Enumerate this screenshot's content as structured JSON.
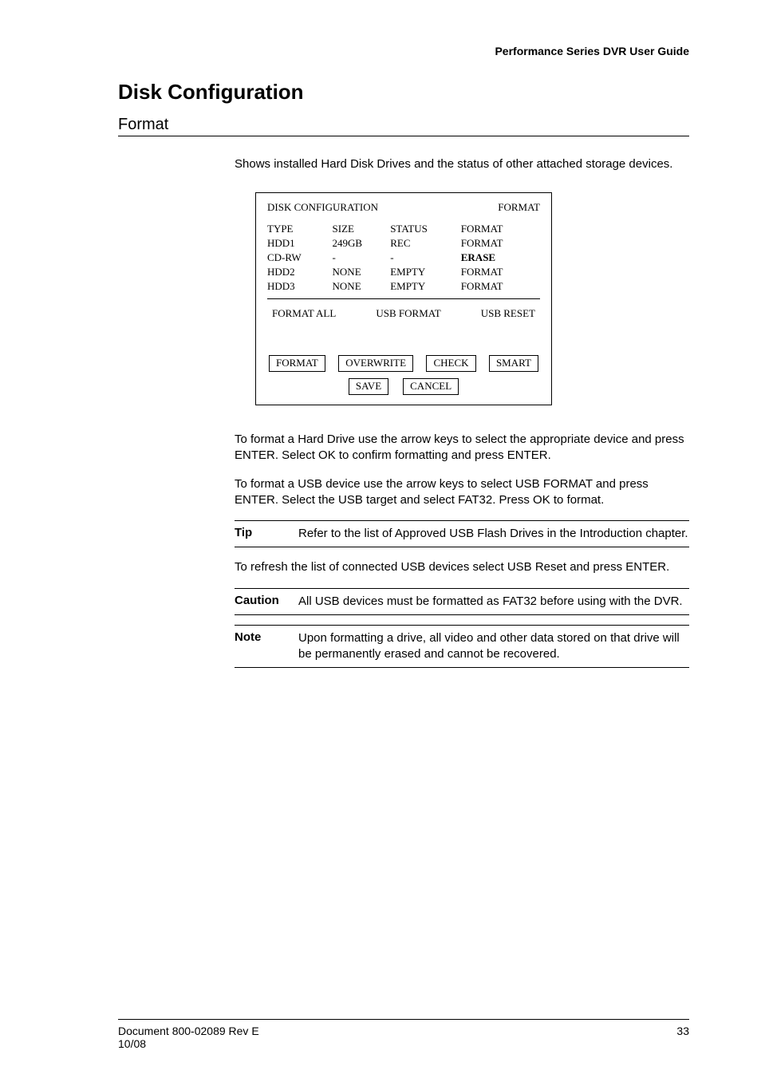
{
  "header": {
    "running_title": "Performance Series DVR User Guide"
  },
  "section": {
    "title": "Disk Configuration"
  },
  "subsection": {
    "heading": "Format",
    "intro": "Shows installed Hard Disk Drives and the status of other attached storage devices."
  },
  "diagram": {
    "title_left": "DISK CONFIGURATION",
    "title_right": "FORMAT",
    "columns": [
      "TYPE",
      "SIZE",
      "STATUS",
      "FORMAT"
    ],
    "rows": [
      {
        "c0": "HDD1",
        "c1": "249GB",
        "c2": "REC",
        "c3": "FORMAT"
      },
      {
        "c0": "CD-RW",
        "c1": "-",
        "c2": "-",
        "c3": "ERASE",
        "c3_bold": true
      },
      {
        "c0": "HDD2",
        "c1": "NONE",
        "c2": "EMPTY",
        "c3": "FORMAT"
      },
      {
        "c0": "HDD3",
        "c1": "NONE",
        "c2": "EMPTY",
        "c3": "FORMAT"
      }
    ],
    "row3": {
      "a": "FORMAT ALL",
      "b": "USB FORMAT",
      "c": "USB RESET"
    },
    "buttons_row1": {
      "a": "FORMAT",
      "b": "OVERWRITE",
      "c": "CHECK",
      "d": "SMART"
    },
    "buttons_row2": {
      "a": "SAVE",
      "b": "CANCEL"
    }
  },
  "body": {
    "p1": "To format a Hard Drive use the arrow keys to select the appropriate device and press ENTER. Select OK to confirm formatting and press ENTER.",
    "p2": "To format a USB device use the arrow keys to select USB FORMAT and press ENTER. Select the USB target and select FAT32. Press OK to format.",
    "p3": "To refresh the list of connected USB devices select USB Reset and press ENTER."
  },
  "tip": {
    "label": "Tip",
    "text": "Refer to the list of Approved USB Flash Drives in the Introduction chapter."
  },
  "caution": {
    "label": "Caution",
    "text": "All USB devices must be formatted as FAT32 before using with the DVR."
  },
  "note": {
    "label": "Note",
    "text": "Upon formatting a drive, all video and other data stored on that drive will be permanently erased and cannot be recovered."
  },
  "footer": {
    "left1": "Document 800-02089  Rev E",
    "left2": "10/08",
    "right": "33"
  }
}
